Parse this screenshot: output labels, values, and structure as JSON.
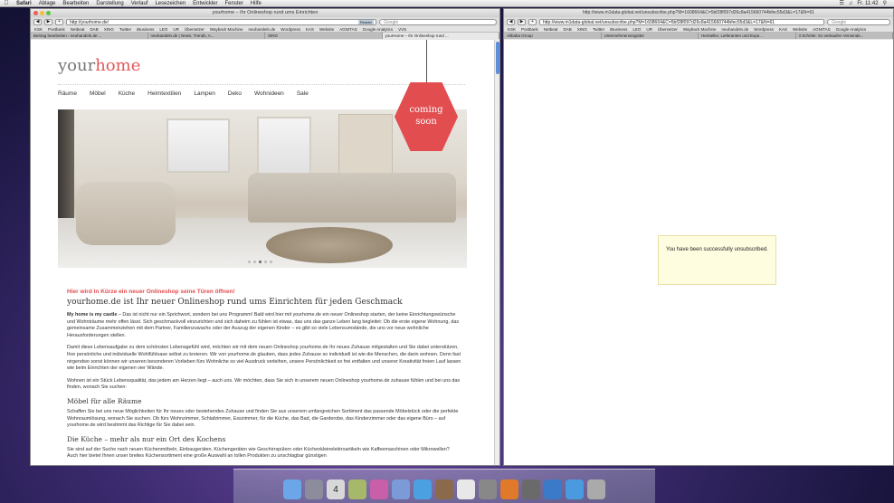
{
  "menubar": {
    "apple": "",
    "items": [
      "Safari",
      "Ablage",
      "Bearbeiten",
      "Darstellung",
      "Verlauf",
      "Lesezeichen",
      "Entwickler",
      "Fenster",
      "Hilfe"
    ],
    "clock": "Fr. 11:42"
  },
  "left_window": {
    "title": "yourhome – Ihr Onlineshop rund ums Einrichten",
    "url": "http://yourhome.de/",
    "rss_label": "Reader",
    "search_placeholder": "Google",
    "bookmarks": [
      "KSK",
      "Postbank",
      "Netbeat",
      "DAB",
      "XING",
      "Twitter",
      "iBusiness",
      "LEO",
      "UR",
      "Übersetzer",
      "Wayback Machine",
      "neuhandeln.de",
      "Wordpress",
      "KAS",
      "Website",
      "AGNITAS",
      "Google Analytics",
      "VVS"
    ],
    "tabs": [
      {
        "label": "Beitrag bearbeiten ‹ neuhandeln.de ...",
        "active": false
      },
      {
        "label": "neuhandeln.de | News, Trends, A...",
        "active": false
      },
      {
        "label": "XING",
        "active": false
      },
      {
        "label": "yourHome – Ihr Onlineshop rund ...",
        "active": true
      }
    ],
    "site": {
      "logo_part1": "your",
      "logo_part2": "home",
      "nav": [
        "Räume",
        "Möbel",
        "Küche",
        "Heimtextilien",
        "Lampen",
        "Deko",
        "Wohnideen",
        "Sale"
      ],
      "badge_line1": "coming",
      "badge_line2": "soon",
      "teaser": "Hier wird in Kürze ein neuer Onlineshop seine Türen öffnen!",
      "headline": "yourhome.de ist Ihr neuer Onlineshop rund ums Einrichten für jeden Geschmack",
      "p1_bold": "My home is my castle",
      "p1": " – Das ist nicht nur ein Sprichwort, sondern bei uns Programm! Bald wird hier mit yourhome.de ein neuer Onlineshop starten, der keine Einrichtungswünsche und Wohnträume mehr offen lässt. Sich geschmackvoll einzurichten und sich daheim zu fühlen ist etwas, das uns das ganze Leben lang begleitet: Ob die erste eigene Wohnung, das gemeinsame Zusammenziehen mit dem Partner, Familienzuwachs oder der Auszug der eigenen Kinder – es gibt so viele Lebensumstände, die uns vor neue wohnliche Herausforderungen stellen.",
      "p2": "Damit diese Lebensaufgabe zu dem schönsten Lebensgefühl wird, möchten wir mit dem neuen Onlineshop yourhome.de Ihr neues Zuhause mitgestalten und Sie dabei unterstützen, Ihre persönliche und individuelle Wohlfühloase selbst zu kreieren. Wir von yourhome.de glauben, dass jedes Zuhause so individuell ist wie die Menschen, die darin wohnen. Denn fast nirgendwo sonst können wir unseren besonderen Vorlieben fürs Wohnliche so viel Ausdruck verleihen, unsere Persönlichkeit so frei entfalten und unserer Kreativität freien Lauf lassen wie beim Einrichten der eigenen vier Wände.",
      "p3": "Wohnen ist ein Stück Lebensqualität, das jedem am Herzen liegt – auch uns. Wir möchten, dass Sie sich in unserem neuen Onlineshop yourhome.de zuhause fühlen und bei uns das finden, wonach Sie suchen:",
      "h2a": "Möbel für alle Räume",
      "p4": "Schaffen Sie bei uns neue Möglichkeiten für Ihr neues oder bestehendes Zuhause und finden Sie aus unserem umfangreichen Sortiment das passende Möbelstück oder die perfekte Wohnraumlösung, wonach Sie suchen. Ob fürs Wohnzimmer, Schlafzimmer, Esszimmer, für die Küche, das Bad, die Garderobe, das Kinderzimmer oder das eigene Büro – auf yourhome.de wird bestimmt das Richtige für Sie dabei sein.",
      "h2b": "Die Küche – mehr als nur ein Ort des Kochens",
      "p5": "Sie sind auf der Suche nach neuen Küchenmöbeln, Einbaugeräten, Küchengeräten wie Geschirrspülern oder Küchenkleinelektroartikeln wie Kaffeemaschinen oder Mikrowellen? Auch hier bietet Ihnen unser breites Küchensortiment eine große Auswahl an tollen Produkten zu unschlagbar günstigen"
    }
  },
  "right_window": {
    "title": "http://www.m1data-global.net/unsubscribe.php?M=1608664&C=5bf28f097d26c8a415660744bfec55d3&L=17&N=61",
    "url": "http://www.m1data-global.net/unsubscribe.php?M=1608664&C=5bf28f097d26c8a415660744bfec55d3&L=17&N=61",
    "search_placeholder": "Google",
    "bookmarks": [
      "KSK",
      "Postbank",
      "Netbeat",
      "DAB",
      "XING",
      "Twitter",
      "iBusiness",
      "LEO",
      "UR",
      "Übersetzer",
      "Wayback Machine",
      "neuhandeln.de",
      "Wordpress",
      "KAS",
      "Website",
      "AGNITAS",
      "Google Analytics"
    ],
    "tabs": [
      {
        "label": "Alibaba Group",
        "active": false
      },
      {
        "label": "Unternehmensregister",
        "active": false
      },
      {
        "label": "Hersteller, Lieferanten und Expe...",
        "active": false
      },
      {
        "label": "3 Schritte: So verkaufen Versende...",
        "active": false
      }
    ],
    "message": "You have been successfully unsubscribed."
  },
  "colors": {
    "accent": "#e24d50",
    "scroll": "#5b8fd8"
  },
  "dock_icons": [
    "finder-icon",
    "rocket-icon",
    "calendar-icon",
    "photo-icon",
    "music-icon",
    "mail-icon",
    "itunes-icon",
    "coffee-icon",
    "textedit-icon",
    "calculator-icon",
    "firefox-icon",
    "gimp-icon",
    "nvu-icon",
    "safari-icon",
    "trash-icon"
  ],
  "dock_calendar_day": "4"
}
